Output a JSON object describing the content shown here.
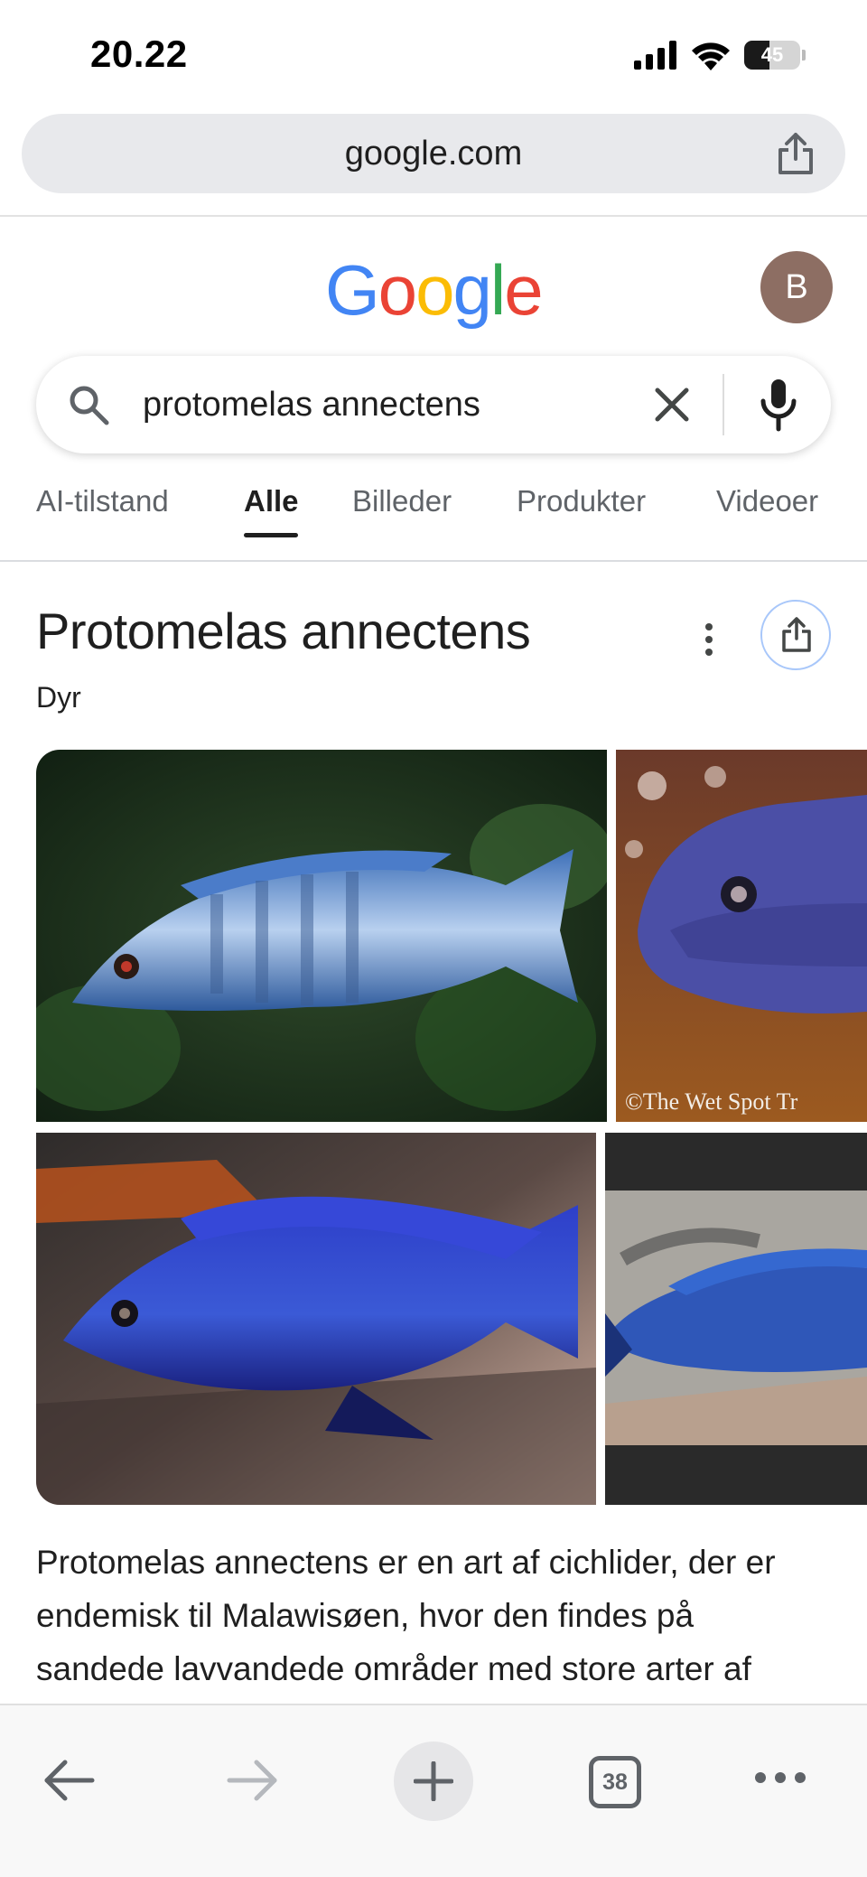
{
  "status_bar": {
    "time": "20.22",
    "battery_level": "45",
    "battery_fraction": 0.45
  },
  "browser": {
    "url": "google.com",
    "open_tabs_count": "38"
  },
  "google": {
    "logo_text": [
      "G",
      "o",
      "o",
      "g",
      "l",
      "e"
    ],
    "logo_colors": [
      "#4285F4",
      "#EA4335",
      "#FBBC05",
      "#4285F4",
      "#34A853",
      "#EA4335"
    ],
    "avatar_initial": "B"
  },
  "search": {
    "query": "protomelas annectens"
  },
  "tabs": [
    {
      "label": "AI-tilstand",
      "active": false
    },
    {
      "label": "Alle",
      "active": true
    },
    {
      "label": "Billeder",
      "active": false
    },
    {
      "label": "Produkter",
      "active": false
    },
    {
      "label": "Videoer",
      "active": false
    }
  ],
  "knowledge_panel": {
    "title": "Protomelas annectens",
    "subtitle": "Dyr",
    "image_watermark": "©The Wet Spot Tr",
    "description": "Protomelas annectens er en art af cichlider, der er endemisk til Malawisøen, hvor den findes på sandede lavvandede områder med store arter af cichlider som grus- og bund på sand og sandbund."
  },
  "icons": {
    "signal": "cellular-signal-icon",
    "wifi": "wifi-icon",
    "share": "share-icon",
    "search": "search-icon",
    "clear": "close-icon",
    "mic": "microphone-icon",
    "more": "more-vertical-icon",
    "back": "arrow-back-icon",
    "forward": "arrow-forward-icon",
    "new_tab": "plus-icon",
    "menu": "more-horizontal-icon"
  },
  "colors": {
    "accent": "#1a73e8",
    "avatar_bg": "#8d6e63",
    "fish_blue": "#2f4fd8"
  }
}
